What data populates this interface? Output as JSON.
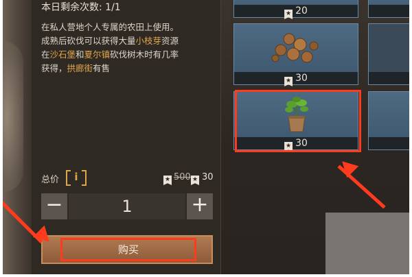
{
  "info": {
    "remaining": "本日剩余次数: 1/1",
    "desc_line1": "在私人营地个人专属的农田上使用。",
    "desc_line2_a": "成熟后砍伐可以获得大量",
    "desc_line2_hl": "小枝芽",
    "desc_line2_b": "资源",
    "desc_line3_a": "在",
    "desc_line3_hl1": "沙石堡",
    "desc_line3_b": "和",
    "desc_line3_hl2": "夏尔镇",
    "desc_line3_c": "砍伐树木时有几率",
    "desc_line4_a": "获得，",
    "desc_line4_hl": "拱廊街",
    "desc_line4_b": "有售"
  },
  "price": {
    "label": "总价",
    "info_symbol": "i",
    "old_price": "500",
    "new_price": "30"
  },
  "quantity": {
    "minus": "−",
    "value": "1",
    "plus": "+"
  },
  "buy_button": {
    "label": "购买"
  },
  "items": [
    {
      "name": "item-1",
      "price": "20",
      "icon": "unknown-item-icon"
    },
    {
      "name": "item-top-right",
      "price": "",
      "icon": "unknown-item-icon"
    },
    {
      "name": "nuts",
      "price": "30",
      "icon": "nuts-icon"
    },
    {
      "name": "item-mid-right",
      "price": "",
      "icon": "unknown-item-icon"
    },
    {
      "name": "sapling",
      "price": "30",
      "icon": "sapling-pot-icon",
      "selected": true
    },
    {
      "name": "item-bottom-right",
      "price": "",
      "icon": "crate-icon"
    }
  ],
  "colors": {
    "highlight": "#e0a64a",
    "annotation": "#ff3b1e",
    "card_blue": "#4e6a82"
  }
}
